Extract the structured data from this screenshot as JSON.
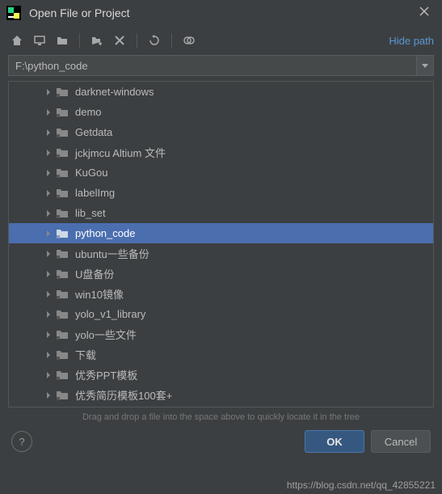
{
  "window": {
    "title": "Open File or Project"
  },
  "toolbar": {
    "hide_path": "Hide path"
  },
  "path": {
    "value": "F:\\python_code"
  },
  "tree": {
    "items": [
      {
        "label": "darknet-windows",
        "selected": false
      },
      {
        "label": "demo",
        "selected": false
      },
      {
        "label": "Getdata",
        "selected": false
      },
      {
        "label": "jckjmcu Altium 文件",
        "selected": false
      },
      {
        "label": "KuGou",
        "selected": false
      },
      {
        "label": "labelImg",
        "selected": false
      },
      {
        "label": "lib_set",
        "selected": false
      },
      {
        "label": "python_code",
        "selected": true
      },
      {
        "label": "ubuntu一些备份",
        "selected": false
      },
      {
        "label": "U盘备份",
        "selected": false
      },
      {
        "label": "win10镜像",
        "selected": false
      },
      {
        "label": "yolo_v1_library",
        "selected": false
      },
      {
        "label": "yolo一些文件",
        "selected": false
      },
      {
        "label": "下载",
        "selected": false
      },
      {
        "label": "优秀PPT模板",
        "selected": false
      },
      {
        "label": "优秀简历模板100套+",
        "selected": false
      }
    ]
  },
  "hint": "Drag and drop a file into the space above to quickly locate it in the tree",
  "buttons": {
    "ok": "OK",
    "cancel": "Cancel",
    "help": "?"
  },
  "watermark": "https://blog.csdn.net/qq_42855221"
}
